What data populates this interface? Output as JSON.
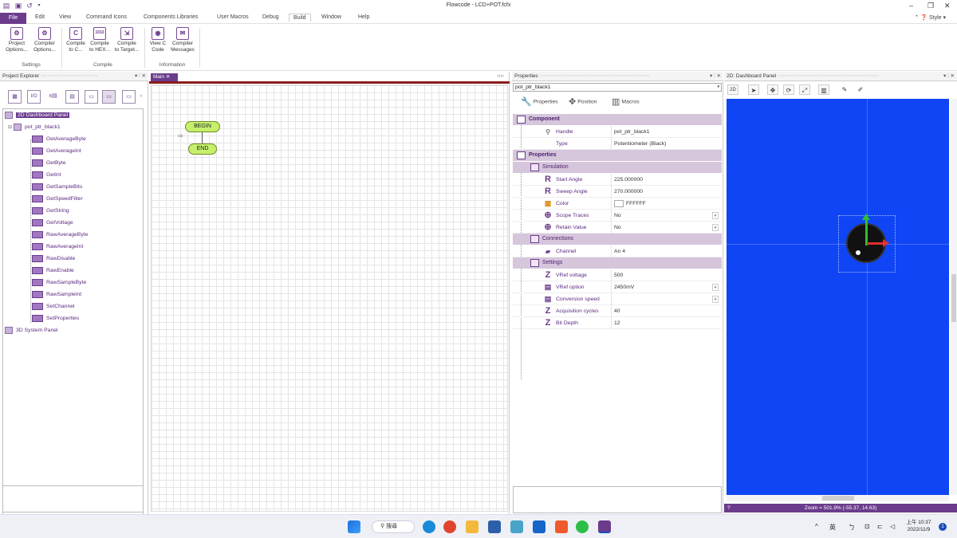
{
  "window": {
    "title": "Flowcode - LCD+POT.fcfx"
  },
  "menu": {
    "items": [
      "File",
      "Edit",
      "View",
      "Command Icons",
      "Components Libraries",
      "User Macros",
      "Debug",
      "Build",
      "Window",
      "Help"
    ],
    "style_label": "Style"
  },
  "ribbon": {
    "buttons": [
      {
        "label1": "Project",
        "label2": "Options...",
        "icon": "project-options-icon"
      },
      {
        "label1": "Compiler",
        "label2": "Options...",
        "icon": "compiler-options-icon"
      },
      {
        "label1": "Compile",
        "label2": "to C...",
        "icon": "compile-c-icon"
      },
      {
        "label1": "Compile",
        "label2": "to HEX...",
        "icon": "compile-hex-icon"
      },
      {
        "label1": "Compile",
        "label2": "to Target...",
        "icon": "compile-target-icon"
      },
      {
        "label1": "View C",
        "label2": "Code",
        "icon": "view-c-code-icon"
      },
      {
        "label1": "Compiler",
        "label2": "Messages",
        "icon": "compiler-messages-icon"
      }
    ],
    "groups": [
      "Settings",
      "Compile",
      "Information"
    ]
  },
  "project_explorer": {
    "title": "Project Explorer",
    "tree": {
      "root1": "2D Dashboard Panel",
      "component": "pot_ptr_black1",
      "macros": [
        "GetAverageByte",
        "GetAverageInt",
        "GetByte",
        "GetInt",
        "GetSampleBits",
        "GetSpeedFilter",
        "GetString",
        "GetVoltage",
        "RawAverageByte",
        "RawAverageInt",
        "RawDisable",
        "RawEnable",
        "RawSampleByte",
        "RawSampleInt",
        "SetChannel",
        "SetProperties"
      ],
      "root2": "3D System Panel"
    }
  },
  "main": {
    "tab": "Main",
    "begin": "BEGIN",
    "end": "END"
  },
  "properties": {
    "title": "Properties",
    "selected": "pot_ptr_black1",
    "tabs": [
      "Properties",
      "Position",
      "Macros"
    ],
    "component_section": "Component",
    "handle": {
      "name": "Handle",
      "value": "pot_ptr_black1"
    },
    "type": {
      "name": "Type",
      "value": "Potentiometer (Black)"
    },
    "properties_section": "Properties",
    "simulation": "Simulation",
    "start_angle": {
      "name": "Start Angle",
      "value": "225.000000"
    },
    "sweep_angle": {
      "name": "Sweep Angle",
      "value": "270.000000"
    },
    "color": {
      "name": "Color",
      "value": "FFFFFF"
    },
    "scope_traces": {
      "name": "Scope Traces",
      "value": "No"
    },
    "retain_value": {
      "name": "Retain Value",
      "value": "No"
    },
    "connections": "Connections",
    "channel": {
      "name": "Channel",
      "value": "An 4"
    },
    "settings": "Settings",
    "vref_voltage": {
      "name": "VRef voltage",
      "value": "500"
    },
    "vref_option": {
      "name": "VRef option",
      "value": "2450mV"
    },
    "conversion_speed": {
      "name": "Conversion speed",
      "value": ""
    },
    "acquisition_cycles": {
      "name": "Acquisition cycles",
      "value": "40"
    },
    "bit_depth": {
      "name": "Bit Depth",
      "value": "12"
    }
  },
  "dashboard": {
    "title": "2D: Dashboard Panel",
    "status": "Zoom = 501.9% (-55.37, 14.63)",
    "canvas_color": "#0f45f5"
  },
  "taskbar": {
    "search": "搜尋",
    "ime1": "英",
    "ime2": "ㄅ",
    "time": "上午 10:37",
    "date": "2022/11/9",
    "notif": "1"
  }
}
